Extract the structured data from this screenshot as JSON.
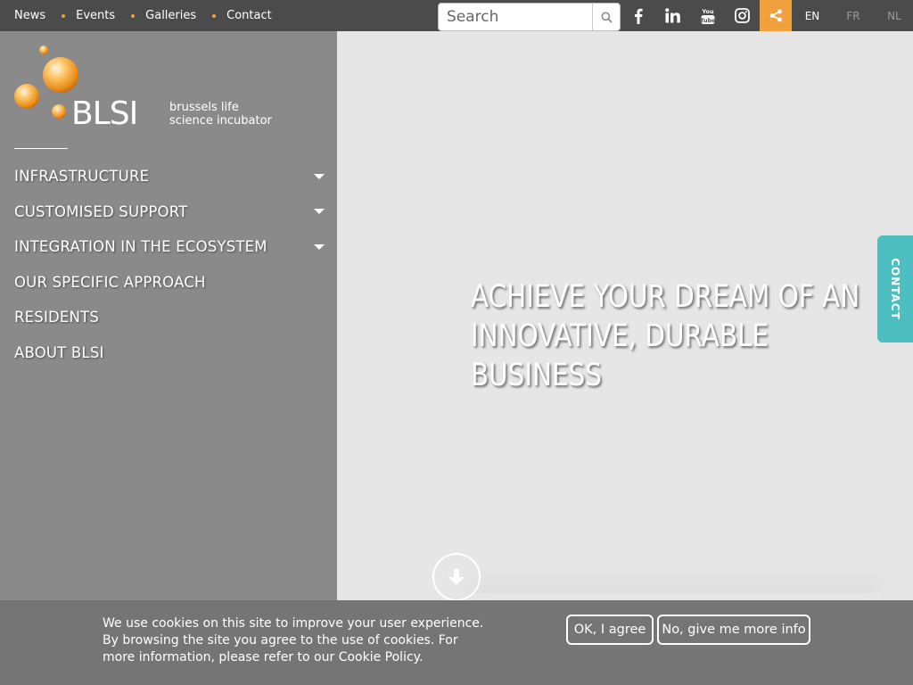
{
  "topnav": {
    "items": [
      "News",
      "Events",
      "Galleries",
      "Contact"
    ]
  },
  "search": {
    "placeholder": "Search",
    "value": ""
  },
  "social": {
    "icons": [
      "facebook-icon",
      "linkedin-icon",
      "youtube-icon",
      "instagram-icon",
      "share-icon"
    ]
  },
  "languages": [
    "EN",
    "FR",
    "NL"
  ],
  "logo": {
    "wordmark": "BLSI",
    "tagline_line1": "brussels life",
    "tagline_line2": "science incubator"
  },
  "menu": [
    {
      "label": "INFRASTRUCTURE",
      "has_submenu": true
    },
    {
      "label": "CUSTOMISED SUPPORT",
      "has_submenu": true
    },
    {
      "label": "INTEGRATION IN THE ECOSYSTEM",
      "has_submenu": true
    },
    {
      "label": "OUR SPECIFIC APPROACH",
      "has_submenu": false
    },
    {
      "label": "RESIDENTS",
      "has_submenu": false
    },
    {
      "label": "ABOUT BLSI",
      "has_submenu": false
    }
  ],
  "hero": {
    "headline": "ACHIEVE YOUR DREAM OF AN INNOVATIVE, DURABLE BUSINESS"
  },
  "contact_tab": "CONTACT",
  "cookie": {
    "message": "We use cookies on this site to improve your user experience. By browsing the site you agree to the use of cookies. For more information, please refer to our Cookie Policy.",
    "agree_label": "OK, I agree",
    "more_label": "No, give me more info"
  },
  "colors": {
    "accent": "#f0a13d",
    "topbar": "#4b4b4b",
    "sidebar": "#8a8a8a",
    "contact_tab": "#4dbfc0",
    "cookie_bar": "#757575"
  }
}
